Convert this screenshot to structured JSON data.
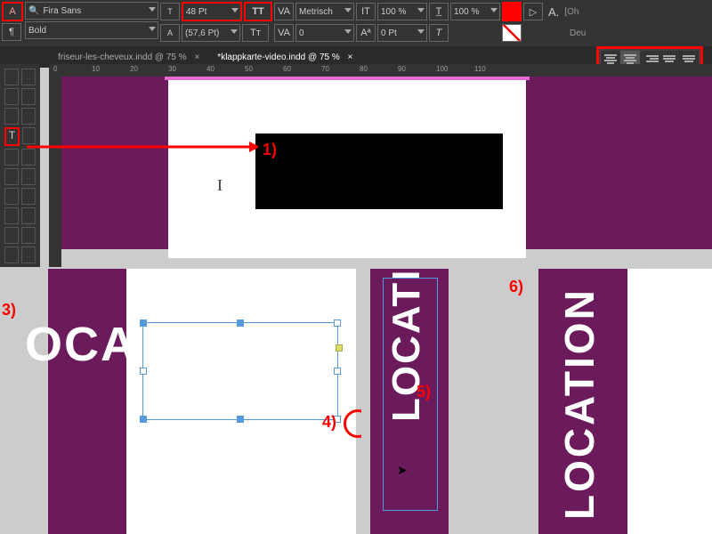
{
  "toolbar": {
    "font": "Fira Sans",
    "weight": "Bold",
    "size": "48 Pt",
    "leading": "(57,6 Pt)",
    "kerning_mode": "Metrisch",
    "tracking": "0",
    "baseline": "0 Pt",
    "scale_v": "100 %",
    "scale_h": "100 %",
    "lang": "Deu",
    "oh": "[Oh"
  },
  "tabs": {
    "doc1": "friseur-les-cheveux.indd @ 75 %",
    "doc2": "*klappkarte-video.indd @ 75 %"
  },
  "ruler": {
    "m0": "0",
    "m10": "10",
    "m20": "20",
    "m30": "30",
    "m40": "40",
    "m50": "50",
    "m60": "60",
    "m70": "70",
    "m80": "80",
    "m90": "90",
    "m100": "100",
    "m110": "110"
  },
  "ann": {
    "a1": "1)",
    "a3": "3)",
    "a4": "4)",
    "a5": "5)",
    "a6": "6)"
  },
  "text": {
    "oca": "OCA",
    "locati": "LOCATI",
    "location": "LOCATION"
  },
  "chart_data": null
}
